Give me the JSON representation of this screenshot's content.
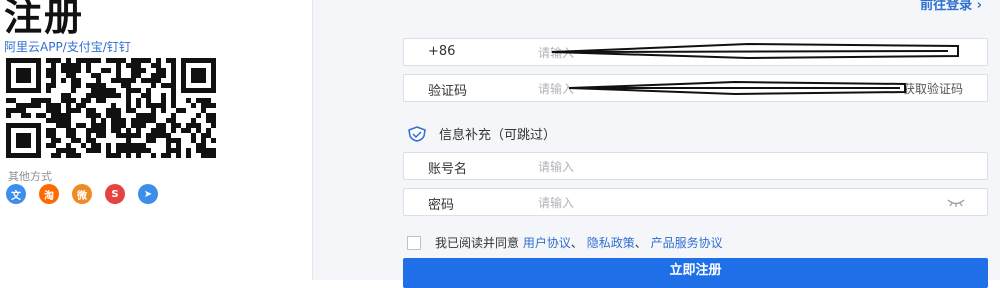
{
  "title": "注册",
  "scan_tip": "阿里云APP/支付宝/钉钉",
  "other_methods": {
    "label": "其他方式",
    "icons": [
      {
        "name": "wenwen-login-icon",
        "glyph": "文",
        "color": "#3b8eea"
      },
      {
        "name": "taobao-login-icon",
        "glyph": "淘",
        "color": "#ff6a00"
      },
      {
        "name": "weibo-login-icon",
        "glyph": "微",
        "color": "#f08a24"
      },
      {
        "name": "sina-login-icon",
        "glyph": "S",
        "color": "#e64340"
      },
      {
        "name": "telegram-login-icon",
        "glyph": "➤",
        "color": "#3c8ee8"
      }
    ]
  },
  "goto_login": "前往登录 ›",
  "phone": {
    "prefix": "+86",
    "placeholder": "请输入"
  },
  "sms": {
    "label": "验证码",
    "placeholder": "请输入",
    "get_code": "获取验证码"
  },
  "info_section": {
    "title": "信息补充（可跳过）"
  },
  "account": {
    "label": "账号名",
    "placeholder": "请输入"
  },
  "password": {
    "label": "密码",
    "placeholder": "请输入"
  },
  "agreement": {
    "prefix": "我已阅读并同意",
    "link1": "用户协议",
    "sep1": "、",
    "link2": "隐私政策",
    "sep2": "、",
    "link3": "产品服务协议"
  },
  "submit_label": "立即注册"
}
